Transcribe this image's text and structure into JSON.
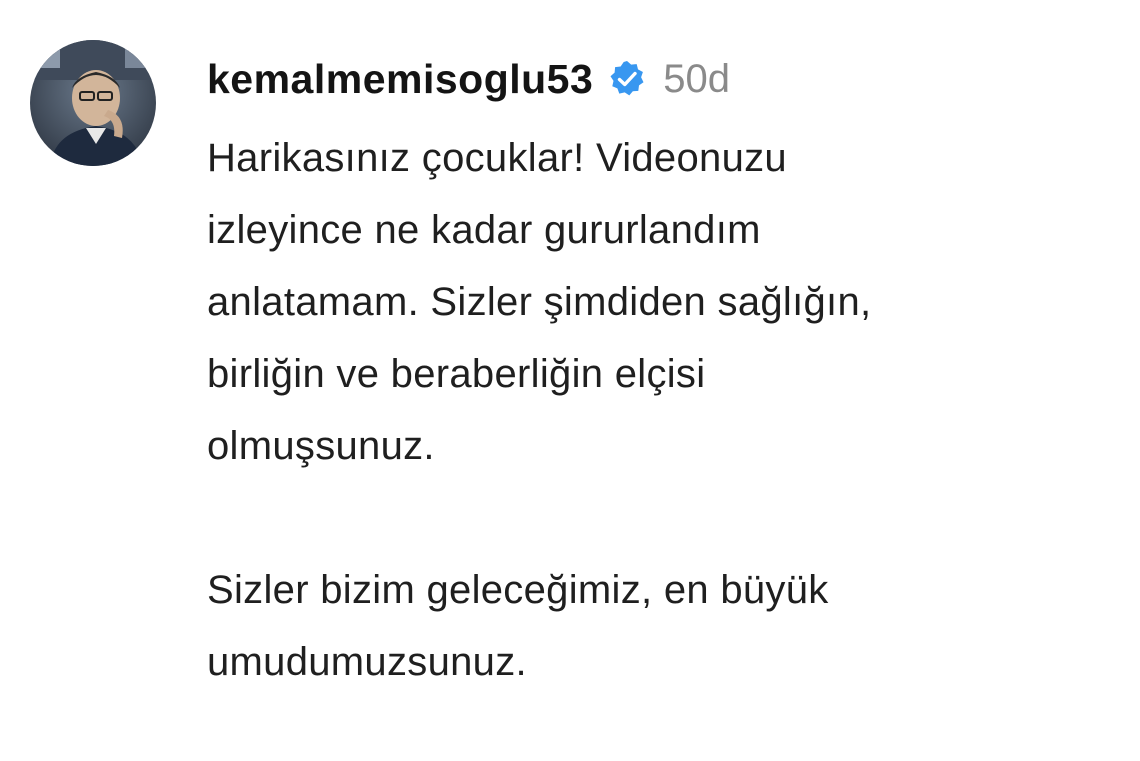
{
  "comment": {
    "username": "kemalmemisoglu53",
    "verified_icon": "verified-badge-icon",
    "time": "50d",
    "lines": [
      "Harikasınız çocuklar! Videonuzu",
      "izleyince ne kadar gururlandım",
      "anlatamam. Sizler şimdiden sağlığın,",
      "birliğin ve beraberliğin elçisi",
      "olmuşsunuz.",
      "",
      "Sizler bizim geleceğimiz, en büyük",
      "umudumuzsunuz."
    ],
    "colors": {
      "verified": "#3897f0",
      "time": "#8a8a8a",
      "text": "#1f1f1f"
    }
  }
}
